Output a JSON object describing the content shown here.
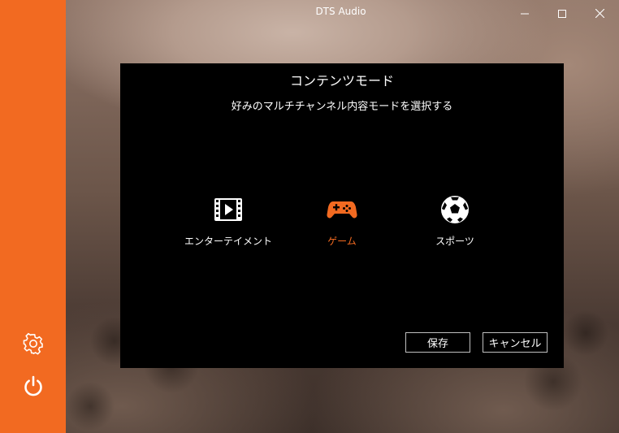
{
  "window": {
    "title": "DTS Audio"
  },
  "sidebar": {
    "accent_color": "#f26a21",
    "items": [
      {
        "icon": "gear-icon"
      },
      {
        "icon": "power-icon"
      }
    ]
  },
  "dialog": {
    "title": "コンテンツモード",
    "subtitle": "好みのマルチチャンネル内容モードを選択する",
    "modes": [
      {
        "label": "エンターテイメント",
        "icon": "film-icon",
        "selected": false
      },
      {
        "label": "ゲーム",
        "icon": "gamepad-icon",
        "selected": true
      },
      {
        "label": "スポーツ",
        "icon": "soccer-ball-icon",
        "selected": false
      }
    ],
    "buttons": {
      "save_label": "保存",
      "cancel_label": "キャンセル"
    },
    "selected_color": "#f26a21"
  }
}
